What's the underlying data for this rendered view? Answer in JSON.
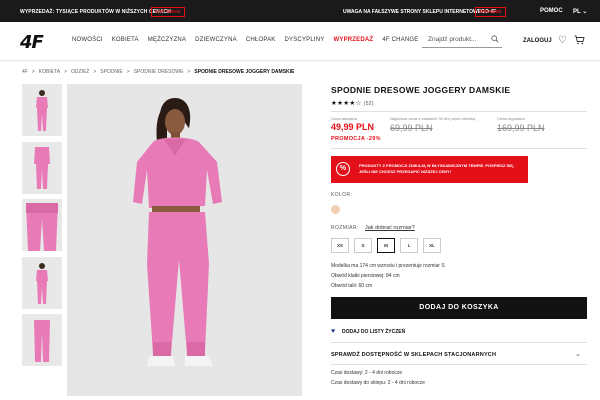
{
  "topbar": {
    "promo_text": "WYPRZEDAŻ: TYSIĄCE PRODUKTÓW W NIŻSZYCH CENACH",
    "promo_button": "KUP TERAZ",
    "warning_text": "UWAGA NA FAŁSZYWE STRONY SKLEPU INTERNETOWEGO 4F",
    "warning_button": "SPRAWDŹ",
    "help": "POMOC",
    "lang": "PL ⌄"
  },
  "header": {
    "logo": "4F",
    "nav": [
      "NOWOŚCI",
      "KOBIETA",
      "MĘŻCZYZNA",
      "DZIEWCZYNA",
      "CHŁOPAK",
      "DYSCYPLINY",
      "WYPRZEDAŻ",
      "4F CHANGE"
    ],
    "search_placeholder": "Znajdź produkt...",
    "login": "ZALOGUJ"
  },
  "breadcrumb": [
    "4F",
    ">",
    "KOBIETA",
    ">",
    "ODZIEŻ",
    ">",
    "SPODNIE",
    ">",
    "SPODNIE DRESOWE",
    ">",
    "SPODNIE DRESOWE JOGGERY DAMSKIE"
  ],
  "product": {
    "title": "SPODNIE DRESOWE JOGGERY DAMSKIE",
    "rating_stars": "★★★★☆",
    "rating_count": "(52)",
    "price_label_now": "Cena aktualna",
    "price_now": "49,99 PLN",
    "price_label_lowest": "Najniższa cena z ostatnich 30 dni przed obniżką",
    "price_lowest": "69,99 PLN",
    "price_label_regular": "Cena regularna",
    "price_regular": "169,99 PLN",
    "promo": "PROMOCJA -29%",
    "banner_text": "PRODUKTY Z PROMOCJI ZNIKAJĄ W BŁYSKAWICZNYM TEMPIE. POSPIESZ SIĘ, JEŚLI NIE CHCESZ PRZEGAPIĆ NIŻSZEJ CENY!",
    "color_label": "KOLOR:",
    "size_label": "ROZMIAR:",
    "size_guide": "Jak dobrać rozmiar?",
    "sizes": [
      "XS",
      "S",
      "M",
      "L",
      "XL"
    ],
    "model_info": "Modelka ma 174 cm wzrostu i prezentuje rozmiar S",
    "chest": "Obwód klatki piersiowej: 84 cm",
    "waist": "Obwód talii: 60 cm",
    "add_to_cart": "DODAJ DO KOSZYKA",
    "wishlist": "DODAJ DO LISTY ŻYCZEŃ",
    "availability": "SPRAWDŹ DOSTĘPNOŚĆ W SKLEPACH STACJONARNYCH",
    "delivery_1": "Czas dostawy: 2 - 4 dni robocze",
    "delivery_2": "Czas dostawy do sklepu: 2 - 4 dni robocze"
  },
  "colors": {
    "accent": "#e3101a",
    "garment": "#e87bb7",
    "swatch": "#f0d0b4"
  }
}
